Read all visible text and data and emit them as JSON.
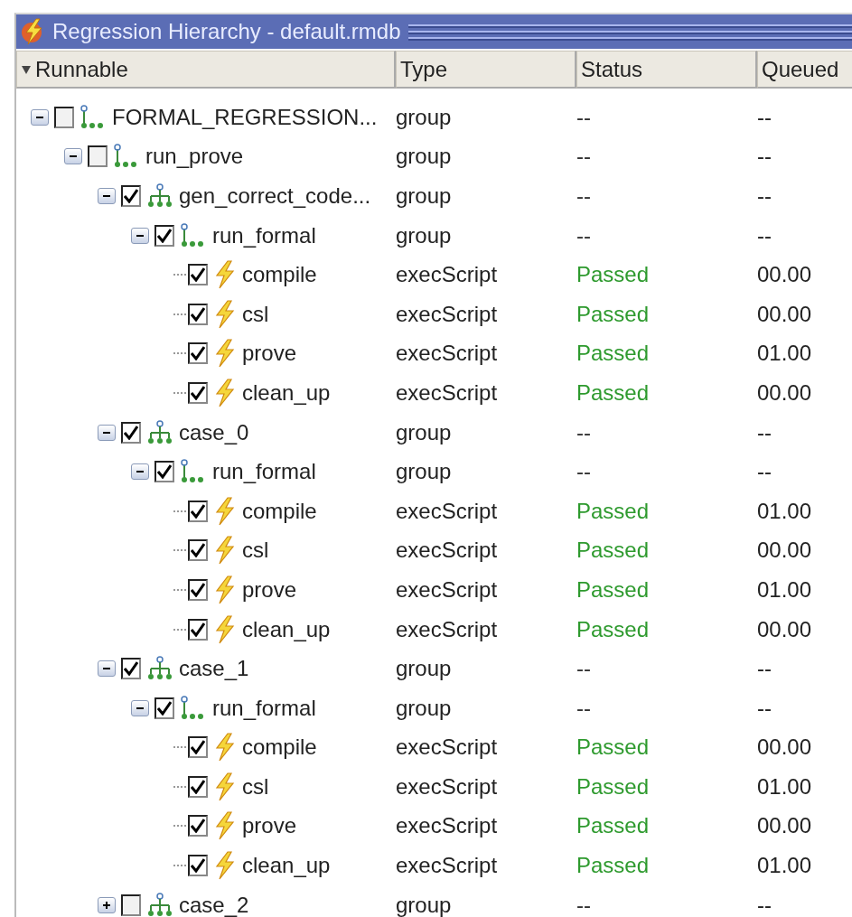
{
  "window": {
    "title": "Regression Hierarchy - default.rmdb"
  },
  "columns": [
    {
      "label": "Runnable",
      "sort_indicator": true
    },
    {
      "label": "Type"
    },
    {
      "label": "Status"
    },
    {
      "label": "Queued"
    }
  ],
  "tree": [
    {
      "name": "FORMAL_REGRESSION...",
      "kind": "sequence",
      "checked": false,
      "expanded": true,
      "type": "group",
      "status": "--",
      "queued": "--",
      "color": "#333333",
      "children": [
        {
          "name": "run_prove",
          "kind": "sequence",
          "checked": false,
          "expanded": true,
          "type": "group",
          "status": "--",
          "queued": "--",
          "color": "#333333",
          "children": [
            {
              "name": "gen_correct_code...",
              "kind": "parallel",
              "checked": true,
              "expanded": true,
              "type": "group",
              "status": "--",
              "queued": "--",
              "color": "#333333",
              "children": [
                {
                  "name": "run_formal",
                  "kind": "sequence",
                  "checked": true,
                  "expanded": true,
                  "type": "group",
                  "status": "--",
                  "queued": "--",
                  "color": "#333333",
                  "children": [
                    {
                      "name": "compile",
                      "kind": "script",
                      "checked": true,
                      "type": "execScript",
                      "status": "Passed",
                      "queued": "00.00",
                      "color": "#2e9a2e"
                    },
                    {
                      "name": "csl",
                      "kind": "script",
                      "checked": true,
                      "type": "execScript",
                      "status": "Passed",
                      "queued": "00.00",
                      "color": "#2e9a2e"
                    },
                    {
                      "name": "prove",
                      "kind": "script",
                      "checked": true,
                      "type": "execScript",
                      "status": "Passed",
                      "queued": "01.00",
                      "color": "#2e9a2e"
                    },
                    {
                      "name": "clean_up",
                      "kind": "script",
                      "checked": true,
                      "type": "execScript",
                      "status": "Passed",
                      "queued": "00.00",
                      "color": "#2e9a2e"
                    }
                  ]
                }
              ]
            },
            {
              "name": "case_0",
              "kind": "parallel",
              "checked": true,
              "expanded": true,
              "type": "group",
              "status": "--",
              "queued": "--",
              "color": "#333333",
              "children": [
                {
                  "name": "run_formal",
                  "kind": "sequence",
                  "checked": true,
                  "expanded": true,
                  "type": "group",
                  "status": "--",
                  "queued": "--",
                  "color": "#333333",
                  "children": [
                    {
                      "name": "compile",
                      "kind": "script",
                      "checked": true,
                      "type": "execScript",
                      "status": "Passed",
                      "queued": "01.00",
                      "color": "#2e9a2e"
                    },
                    {
                      "name": "csl",
                      "kind": "script",
                      "checked": true,
                      "type": "execScript",
                      "status": "Passed",
                      "queued": "00.00",
                      "color": "#2e9a2e"
                    },
                    {
                      "name": "prove",
                      "kind": "script",
                      "checked": true,
                      "type": "execScript",
                      "status": "Passed",
                      "queued": "01.00",
                      "color": "#2e9a2e"
                    },
                    {
                      "name": "clean_up",
                      "kind": "script",
                      "checked": true,
                      "type": "execScript",
                      "status": "Passed",
                      "queued": "00.00",
                      "color": "#2e9a2e"
                    }
                  ]
                }
              ]
            },
            {
              "name": "case_1",
              "kind": "parallel",
              "checked": true,
              "expanded": true,
              "type": "group",
              "status": "--",
              "queued": "--",
              "color": "#333333",
              "children": [
                {
                  "name": "run_formal",
                  "kind": "sequence",
                  "checked": true,
                  "expanded": true,
                  "type": "group",
                  "status": "--",
                  "queued": "--",
                  "color": "#333333",
                  "children": [
                    {
                      "name": "compile",
                      "kind": "script",
                      "checked": true,
                      "type": "execScript",
                      "status": "Passed",
                      "queued": "00.00",
                      "color": "#2e9a2e"
                    },
                    {
                      "name": "csl",
                      "kind": "script",
                      "checked": true,
                      "type": "execScript",
                      "status": "Passed",
                      "queued": "01.00",
                      "color": "#2e9a2e"
                    },
                    {
                      "name": "prove",
                      "kind": "script",
                      "checked": true,
                      "type": "execScript",
                      "status": "Passed",
                      "queued": "00.00",
                      "color": "#2e9a2e"
                    },
                    {
                      "name": "clean_up",
                      "kind": "script",
                      "checked": true,
                      "type": "execScript",
                      "status": "Passed",
                      "queued": "01.00",
                      "color": "#2e9a2e"
                    }
                  ]
                }
              ]
            },
            {
              "name": "case_2",
              "kind": "parallel",
              "checked": false,
              "expanded": false,
              "type": "group",
              "status": "--",
              "queued": "--",
              "color": "#333333"
            }
          ]
        }
      ]
    }
  ]
}
